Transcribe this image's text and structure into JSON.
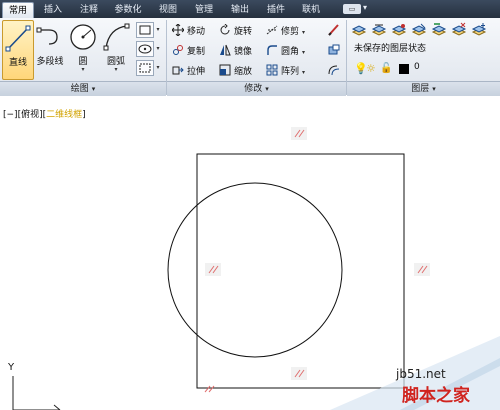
{
  "tabs": [
    {
      "label": "常用",
      "active": true
    },
    {
      "label": "插入",
      "active": false
    },
    {
      "label": "注释",
      "active": false
    },
    {
      "label": "参数化",
      "active": false
    },
    {
      "label": "视图",
      "active": false
    },
    {
      "label": "管理",
      "active": false
    },
    {
      "label": "输出",
      "active": false
    },
    {
      "label": "插件",
      "active": false
    },
    {
      "label": "联机",
      "active": false
    }
  ],
  "draw_panel": {
    "title": "绘图",
    "tools": [
      {
        "label": "直线",
        "icon": "line-icon",
        "selected": true
      },
      {
        "label": "多段线",
        "icon": "polyline-icon",
        "selected": false
      },
      {
        "label": "圆",
        "icon": "circle-icon",
        "selected": false
      },
      {
        "label": "圆弧",
        "icon": "arc-icon",
        "selected": false
      }
    ],
    "small_buttons": [
      "rectangle-icon",
      "ellipse-icon",
      "hatch-icon"
    ]
  },
  "modify_panel": {
    "title": "修改",
    "tools": [
      {
        "label": "移动",
        "icon": "move-icon",
        "dropdown": false
      },
      {
        "label": "旋转",
        "icon": "rotate-icon",
        "dropdown": false
      },
      {
        "label": "修剪",
        "icon": "trim-icon",
        "dropdown": true
      },
      {
        "label": "复制",
        "icon": "copy-icon",
        "dropdown": false
      },
      {
        "label": "镜像",
        "icon": "mirror-icon",
        "dropdown": false
      },
      {
        "label": "圆角",
        "icon": "fillet-icon",
        "dropdown": true
      },
      {
        "label": "拉伸",
        "icon": "stretch-icon",
        "dropdown": false
      },
      {
        "label": "缩放",
        "icon": "scale-icon",
        "dropdown": false
      },
      {
        "label": "阵列",
        "icon": "array-icon",
        "dropdown": true
      }
    ]
  },
  "layer_panel": {
    "title": "图层",
    "state_combo": "未保存的图层状态",
    "current_layer": "0",
    "layer_color": "#000000"
  },
  "viewport": {
    "label_prefix": "[−][俯视][",
    "label_highlight": "二维线框",
    "label_suffix": "]",
    "axis_y": "Y"
  },
  "watermark": {
    "site": "jb51.net",
    "name": "脚本之家"
  },
  "colors": {
    "accent": "#d1a200",
    "watermark_red": "#d0241f",
    "snap_marker": "#e07070"
  }
}
